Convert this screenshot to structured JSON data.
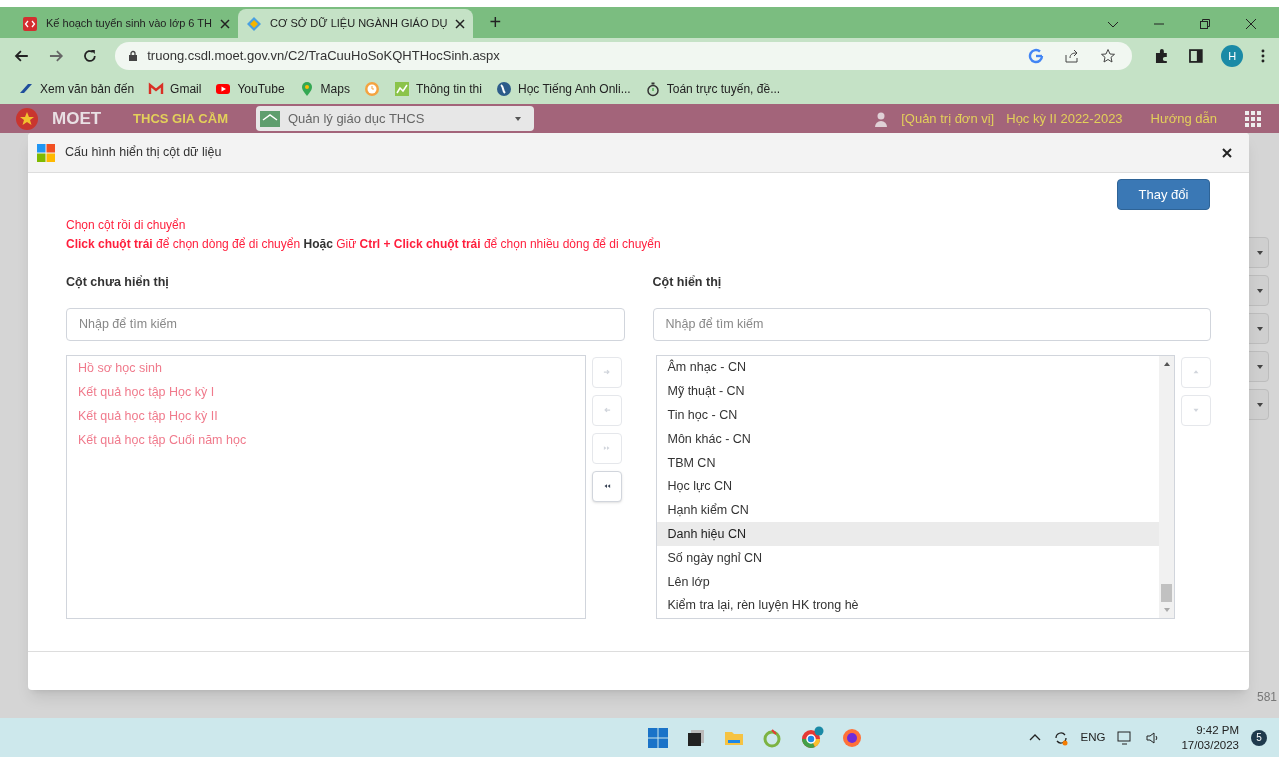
{
  "browser": {
    "tabs": [
      {
        "title": "Kế hoạch tuyển sinh vào lớp 6 TH",
        "kind": "code",
        "selected": false
      },
      {
        "title": "CƠ SỞ DỮ LIỆU NGÀNH GIÁO DỤ",
        "kind": "diamond",
        "selected": true
      }
    ],
    "new_tab": "+",
    "address": "truong.csdl.moet.gov.vn/C2/TraCuuHoSoKQHTHocSinh.aspx",
    "profile": "H",
    "bookmarks": [
      {
        "label": "Xem văn bản đến",
        "kind": "swoosh"
      },
      {
        "label": "Gmail",
        "kind": "mail"
      },
      {
        "label": "YouTube",
        "kind": "video"
      },
      {
        "label": "Maps",
        "kind": "pin"
      },
      {
        "kind": "clock"
      },
      {
        "label": "Thông tin thi",
        "kind": "chart"
      },
      {
        "label": "Học Tiếng Anh Onli...",
        "kind": "globe"
      },
      {
        "label": "Toán trực tuyến, đề...",
        "kind": "stopwatch"
      }
    ]
  },
  "site_header": {
    "logo": "MOET",
    "school": "THCS GIA CẦM",
    "module": "Quản lý giáo dục THCS",
    "role": "[Quản trị đơn vị]",
    "term": "Học kỳ II 2022-2023",
    "help": "Hướng dẫn"
  },
  "page": {
    "count": "581"
  },
  "dialog": {
    "title": "Cấu hình hiển thị cột dữ liệu",
    "apply_button": "Thay đổi",
    "hint": "Chọn cột rồi di chuyển",
    "instructions": [
      {
        "text": "Click chuột trái",
        "bold": true,
        "kind": "alert"
      },
      {
        "text": " để chọn dòng để di chuyển ",
        "bold": false,
        "kind": "alert"
      },
      {
        "text": "Hoặc",
        "bold": true,
        "kind": "plain"
      },
      {
        "text": " Giữ ",
        "bold": false,
        "kind": "alert"
      },
      {
        "text": "Ctrl + Click chuột trái",
        "bold": true,
        "kind": "alert"
      },
      {
        "text": " để chọn nhiều dòng để di chuyển",
        "bold": false,
        "kind": "alert"
      }
    ],
    "hidden_columns": {
      "heading": "Cột chưa hiển thị",
      "placeholder": "Nhập để tìm kiếm",
      "items": [
        {
          "label": "Hồ sơ học sinh",
          "selected": false
        },
        {
          "label": "Kết quả học tập Học kỳ I",
          "selected": false
        },
        {
          "label": "Kết quả học tập Học kỳ II",
          "selected": false
        },
        {
          "label": "Kết quả học tập Cuối năm học",
          "selected": false
        }
      ]
    },
    "move_buttons": [
      {
        "kind": "right",
        "disabled": true
      },
      {
        "kind": "left",
        "disabled": true
      },
      {
        "kind": "all-right",
        "disabled": true
      },
      {
        "kind": "all-left",
        "disabled": false
      }
    ],
    "shown_columns": {
      "heading": "Cột hiển thị",
      "placeholder": "Nhập để tìm kiếm",
      "items": [
        {
          "label": "Âm nhạc - CN",
          "selected": false
        },
        {
          "label": "Mỹ thuật - CN",
          "selected": false
        },
        {
          "label": "Tin học - CN",
          "selected": false
        },
        {
          "label": "Môn khác - CN",
          "selected": false
        },
        {
          "label": "TBM CN",
          "selected": false
        },
        {
          "label": "Học lực CN",
          "selected": false
        },
        {
          "label": "Hạnh kiểm CN",
          "selected": false
        },
        {
          "label": "Danh hiệu CN",
          "selected": true
        },
        {
          "label": "Số ngày nghỉ CN",
          "selected": false
        },
        {
          "label": "Lên lớp",
          "selected": false
        },
        {
          "label": "Kiểm tra lại, rèn luyện HK trong hè",
          "selected": false
        }
      ]
    },
    "order_buttons": [
      {
        "kind": "up",
        "disabled": true
      },
      {
        "kind": "down",
        "disabled": true
      }
    ]
  },
  "taskbar": {
    "language": "ENG",
    "time": "9:42 PM",
    "date": "17/03/2023",
    "notifications": "5"
  }
}
